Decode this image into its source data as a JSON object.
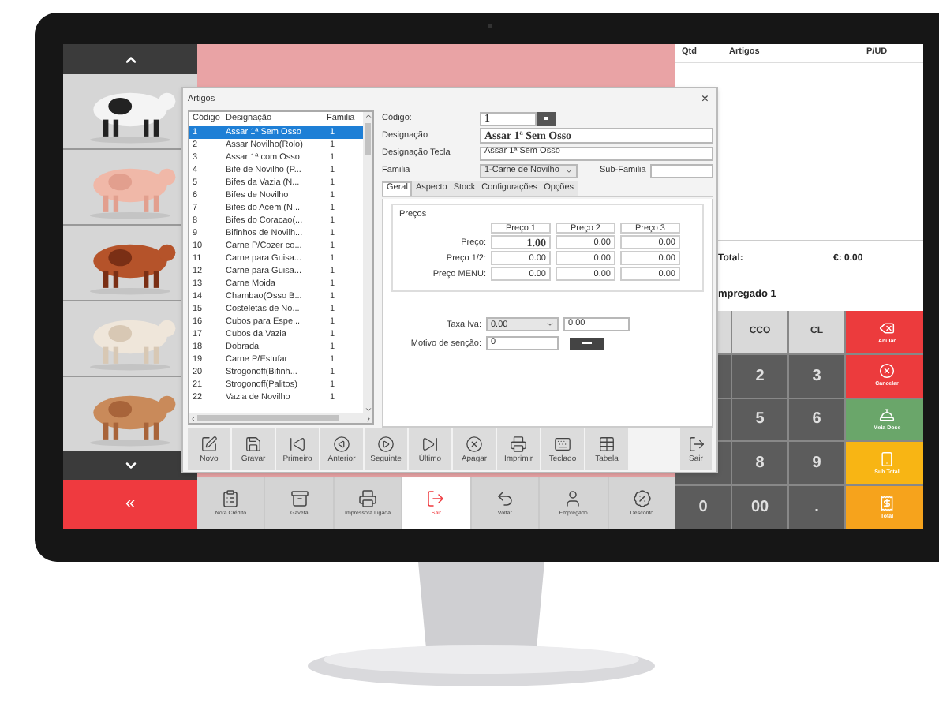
{
  "sidebar": {
    "back": "«"
  },
  "order": {
    "columns": [
      "Qtd",
      "Artigos",
      "P/UD"
    ],
    "total_label": "Total:",
    "total_value": "€: 0.00",
    "employee": "mpregado 1"
  },
  "keypad": [
    [
      {
        "kind": "light"
      },
      {
        "kind": "light",
        "label": "CCO"
      },
      {
        "kind": "light",
        "label": "CL"
      },
      {
        "kind": "action",
        "label": "Anular",
        "color": "#ec3b3d"
      }
    ],
    [
      {
        "kind": "dark"
      },
      {
        "kind": "dark",
        "label": "2"
      },
      {
        "kind": "dark",
        "label": "3"
      },
      {
        "kind": "action",
        "label": "Cancelar",
        "color": "#ec3b3d"
      }
    ],
    [
      {
        "kind": "dark"
      },
      {
        "kind": "dark",
        "label": "5"
      },
      {
        "kind": "dark",
        "label": "6"
      },
      {
        "kind": "action",
        "label": "Meia Dose",
        "color": "#6aa66a"
      }
    ],
    [
      {
        "kind": "dark"
      },
      {
        "kind": "dark",
        "label": "8"
      },
      {
        "kind": "dark",
        "label": "9"
      },
      {
        "kind": "action",
        "label": "Sub Total",
        "color": "#f8b514"
      }
    ],
    [
      {
        "kind": "dark",
        "label": "0"
      },
      {
        "kind": "dark",
        "label": "00"
      },
      {
        "kind": "dark",
        "label": "."
      },
      {
        "kind": "action",
        "label": "Total",
        "color": "#f6a31c"
      }
    ]
  ],
  "bottom_bar": [
    {
      "label": "Nota Crédito",
      "selected": false
    },
    {
      "label": "Gaveta",
      "selected": false
    },
    {
      "label": "Impressora Ligada",
      "selected": false
    },
    {
      "label": "Sair",
      "selected": true
    },
    {
      "label": "Voltar",
      "selected": false
    },
    {
      "label": "Empregado",
      "selected": false
    },
    {
      "label": "Desconto",
      "selected": false
    }
  ],
  "dialog": {
    "title": "Artigos",
    "close": "×",
    "list": {
      "columns": [
        "Código",
        "Designação",
        "Familia"
      ],
      "rows": [
        {
          "cells": [
            "1",
            "Assar 1ª Sem Osso",
            "1"
          ],
          "selected": true
        },
        {
          "cells": [
            "2",
            "Assar Novilho(Rolo)",
            "1"
          ],
          "selected": false
        },
        {
          "cells": [
            "3",
            "Assar 1ª com Osso",
            "1"
          ],
          "selected": false
        },
        {
          "cells": [
            "4",
            "Bife de Novilho (P...",
            "1"
          ],
          "selected": false
        },
        {
          "cells": [
            "5",
            "Bifes da Vazia (N...",
            "1"
          ],
          "selected": false
        },
        {
          "cells": [
            "6",
            "Bifes de Novilho",
            "1"
          ],
          "selected": false
        },
        {
          "cells": [
            "7",
            "Bifes do Acem (N...",
            "1"
          ],
          "selected": false
        },
        {
          "cells": [
            "8",
            "Bifes do Coracao(...",
            "1"
          ],
          "selected": false
        },
        {
          "cells": [
            "9",
            "Bifinhos de Novilh...",
            "1"
          ],
          "selected": false
        },
        {
          "cells": [
            "10",
            "Carne P/Cozer co...",
            "1"
          ],
          "selected": false
        },
        {
          "cells": [
            "11",
            "Carne para Guisa...",
            "1"
          ],
          "selected": false
        },
        {
          "cells": [
            "12",
            "Carne para Guisa...",
            "1"
          ],
          "selected": false
        },
        {
          "cells": [
            "13",
            "Carne Moida",
            "1"
          ],
          "selected": false
        },
        {
          "cells": [
            "14",
            "Chambao(Osso B...",
            "1"
          ],
          "selected": false
        },
        {
          "cells": [
            "15",
            "Costeletas de No...",
            "1"
          ],
          "selected": false
        },
        {
          "cells": [
            "16",
            "Cubos para Espe...",
            "1"
          ],
          "selected": false
        },
        {
          "cells": [
            "17",
            "Cubos da Vazia",
            "1"
          ],
          "selected": false
        },
        {
          "cells": [
            "18",
            "Dobrada",
            "1"
          ],
          "selected": false
        },
        {
          "cells": [
            "19",
            "Carne P/Estufar",
            "1"
          ],
          "selected": false
        },
        {
          "cells": [
            "20",
            "Strogonoff(Bifinh...",
            "1"
          ],
          "selected": false
        },
        {
          "cells": [
            "21",
            "Strogonoff(Palitos)",
            "1"
          ],
          "selected": false
        },
        {
          "cells": [
            "22",
            "Vazia de Novilho",
            "1"
          ],
          "selected": false
        }
      ]
    },
    "form": {
      "code_label": "Código:",
      "code": "1",
      "name_label": "Designação",
      "name": "Assar 1ª Sem Osso",
      "key_label": "Designação Tecla",
      "key_name": "Assar 1ª Sem Osso",
      "family_label": "Familia",
      "family": "1-Carne de Novilho",
      "subfamily_label": "Sub-Familia",
      "tabs": [
        {
          "label": "Geral",
          "selected": true
        },
        {
          "label": "Aspecto",
          "selected": false
        },
        {
          "label": "Stock",
          "selected": false
        },
        {
          "label": "Configurações",
          "selected": false
        },
        {
          "label": "Opções",
          "selected": false
        }
      ],
      "prices": {
        "title": "Preços",
        "columns": [
          "Preço 1",
          "Preço 2",
          "Preço 3"
        ],
        "rows": [
          {
            "label": "Preço:",
            "values": [
              "1.00",
              "0.00",
              "0.00"
            ],
            "first_bold": true
          },
          {
            "label": "Preço 1/2:",
            "values": [
              "0.00",
              "0.00",
              "0.00"
            ],
            "first_bold": false
          },
          {
            "label": "Preço MENU:",
            "values": [
              "0.00",
              "0.00",
              "0.00"
            ],
            "first_bold": false
          }
        ]
      },
      "tax_label": "Taxa Iva:",
      "tax": "0.00",
      "tax_amount": "0.00",
      "reason_label": "Motivo de senção:",
      "reason": "0"
    },
    "toolbar": [
      "Novo",
      "Gravar",
      "Primeiro",
      "Anterior",
      "Seguinte",
      "Último",
      "Apagar",
      "Imprimir",
      "Teclado",
      "Tabela"
    ],
    "exit": "Sair"
  }
}
